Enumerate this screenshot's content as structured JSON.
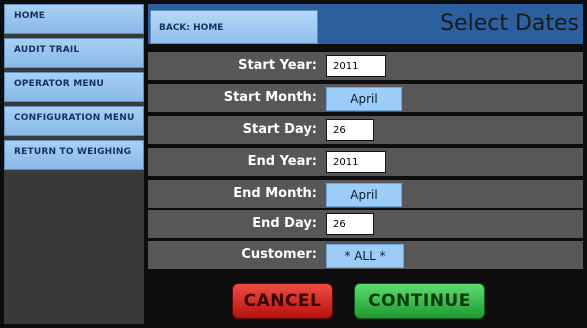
{
  "sidebar": {
    "items": [
      {
        "label": "HOME"
      },
      {
        "label": "AUDIT TRAIL"
      },
      {
        "label": "OPERATOR MENU"
      },
      {
        "label": "CONFIGURATION MENU"
      },
      {
        "label": "RETURN TO WEIGHING"
      }
    ]
  },
  "header": {
    "back_label": "BACK: HOME",
    "title": "Select Dates"
  },
  "form": {
    "start_year": {
      "label": "Start Year:",
      "value": "2011"
    },
    "start_month": {
      "label": "Start Month:",
      "value": "April"
    },
    "start_day": {
      "label": "Start Day:",
      "value": "26"
    },
    "end_year": {
      "label": "End Year:",
      "value": "2011"
    },
    "end_month": {
      "label": "End Month:",
      "value": "April"
    },
    "end_day": {
      "label": "End Day:",
      "value": "26"
    },
    "customer": {
      "label": "Customer:",
      "value": "* ALL *"
    }
  },
  "actions": {
    "cancel_label": "CANCEL",
    "continue_label": "CONTINUE"
  },
  "colors": {
    "sidebar_button": "#9fc9f0",
    "header_bar": "#2c5f9e",
    "row_background": "#575757",
    "cancel": "#d8231b",
    "continue": "#33b947"
  }
}
